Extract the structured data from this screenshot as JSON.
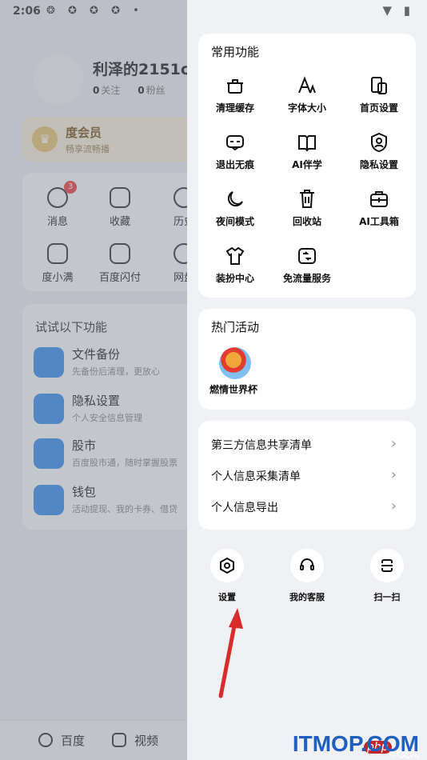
{
  "status": {
    "time": "2:06",
    "icons": "❂ ✪ ✪ ✪ •",
    "right": "▼ ▮"
  },
  "profile": {
    "name": "利泽的2151c",
    "following_count": "0",
    "following_label": "关注",
    "fans_count": "0",
    "fans_label": "粉丝"
  },
  "vip": {
    "title": "度会员",
    "subtitle": "畅享流畅播"
  },
  "quick_grid": [
    {
      "label": "消息",
      "badge": "3"
    },
    {
      "label": "收藏"
    },
    {
      "label": "历史"
    },
    {
      "label": "度小满"
    },
    {
      "label": "百度闪付"
    },
    {
      "label": "网盘"
    }
  ],
  "try_section": {
    "title": "试试以下功能",
    "items": [
      {
        "name": "文件备份",
        "desc": "先备份后清理，更放心"
      },
      {
        "name": "隐私设置",
        "desc": "个人安全信息管理"
      },
      {
        "name": "股市",
        "desc": "百度股市通，随时掌握股票"
      },
      {
        "name": "钱包",
        "desc": "活动提现、我的卡券、借贷"
      }
    ]
  },
  "tabbar": [
    {
      "label": "百度"
    },
    {
      "label": "视频"
    }
  ],
  "drawer": {
    "common_title": "常用功能",
    "common_items": [
      {
        "label": "清理缓存",
        "icon": "trash-clean-icon"
      },
      {
        "label": "字体大小",
        "icon": "font-size-icon"
      },
      {
        "label": "首页设置",
        "icon": "home-setting-icon"
      },
      {
        "label": "退出无痕",
        "icon": "incognito-icon"
      },
      {
        "label": "AI伴学",
        "icon": "book-icon"
      },
      {
        "label": "隐私设置",
        "icon": "privacy-shield-icon"
      },
      {
        "label": "夜间模式",
        "icon": "moon-icon"
      },
      {
        "label": "回收站",
        "icon": "recycle-bin-icon"
      },
      {
        "label": "AI工具箱",
        "icon": "toolbox-icon"
      },
      {
        "label": "装扮中心",
        "icon": "tshirt-icon"
      },
      {
        "label": "免流量服务",
        "icon": "data-free-icon"
      }
    ],
    "hot_title": "热门活动",
    "hot_items": [
      {
        "label": "燃情世界杯",
        "icon": "world-cup-icon"
      }
    ],
    "list_items": [
      {
        "label": "第三方信息共享清单"
      },
      {
        "label": "个人信息采集清单"
      },
      {
        "label": "个人信息导出"
      }
    ],
    "chevron": "›",
    "bottom_items": [
      {
        "label": "设置",
        "icon": "settings-icon"
      },
      {
        "label": "我的客服",
        "icon": "customer-service-icon"
      },
      {
        "label": "扫一扫",
        "icon": "scan-icon"
      }
    ]
  },
  "watermark": {
    "text": "ITMOP.COM",
    "php": "php",
    "cn": "中文网"
  },
  "colors": {
    "accent": "#3a8ef2",
    "arrow": "#d92b2b",
    "badge": "#f04040"
  }
}
